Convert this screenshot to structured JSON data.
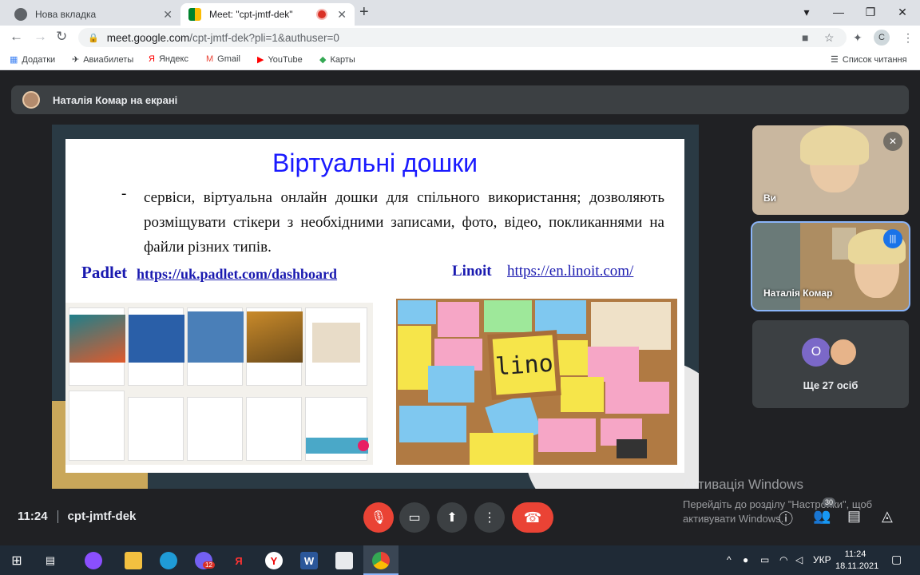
{
  "browser": {
    "tabs": [
      {
        "title": "Нова вкладка",
        "active": false
      },
      {
        "title": "Meet: \"cpt-jmtf-dek\"",
        "active": true
      }
    ],
    "url_host": "meet.google.com",
    "url_path": "/cpt-jmtf-dek?pli=1&authuser=0",
    "profile_initial": "C",
    "bookmarks": [
      "Додатки",
      "Авиабилеты",
      "Яндекс",
      "Gmail",
      "YouTube",
      "Карты"
    ],
    "reading_list": "Список читання"
  },
  "meet": {
    "presenting_banner": "Наталія Комар на екрані",
    "time": "11:24",
    "meeting_code": "cpt-jmtf-dek",
    "people_count": "30",
    "participants": [
      {
        "name": "Ви",
        "muted": true
      },
      {
        "name": "Наталія Комар",
        "speaking": true
      }
    ],
    "others_initial": "О",
    "others_label": "Ще 27 осіб"
  },
  "slide": {
    "title": "Віртуальні дошки",
    "bullet": "-",
    "body": "сервіси, віртуальна онлайн дошки для спільного використання; дозволяють розміщувати стікери з необхідними записами, фото, відео, покликаннями на файли різних типів.",
    "padlet_label": "Padlet",
    "padlet_url": "https://uk.padlet.com/dashboard",
    "linoit_label": "Linoit",
    "linoit_url": "https://en.linoit.com/",
    "lino_logo": "lino"
  },
  "activation": {
    "title": "Активація Windows",
    "line1": "Перейдіть до розділу \"Настройки\", щоб",
    "line2": "активувати Windows."
  },
  "taskbar": {
    "time": "11:24",
    "date": "18.11.2021",
    "lang": "УКР",
    "viber_badge": "12"
  },
  "colors": {
    "meet_bg": "#202124",
    "end_call": "#ea4335",
    "slide_title": "#1a1aff",
    "speaking": "#1a73e8"
  }
}
